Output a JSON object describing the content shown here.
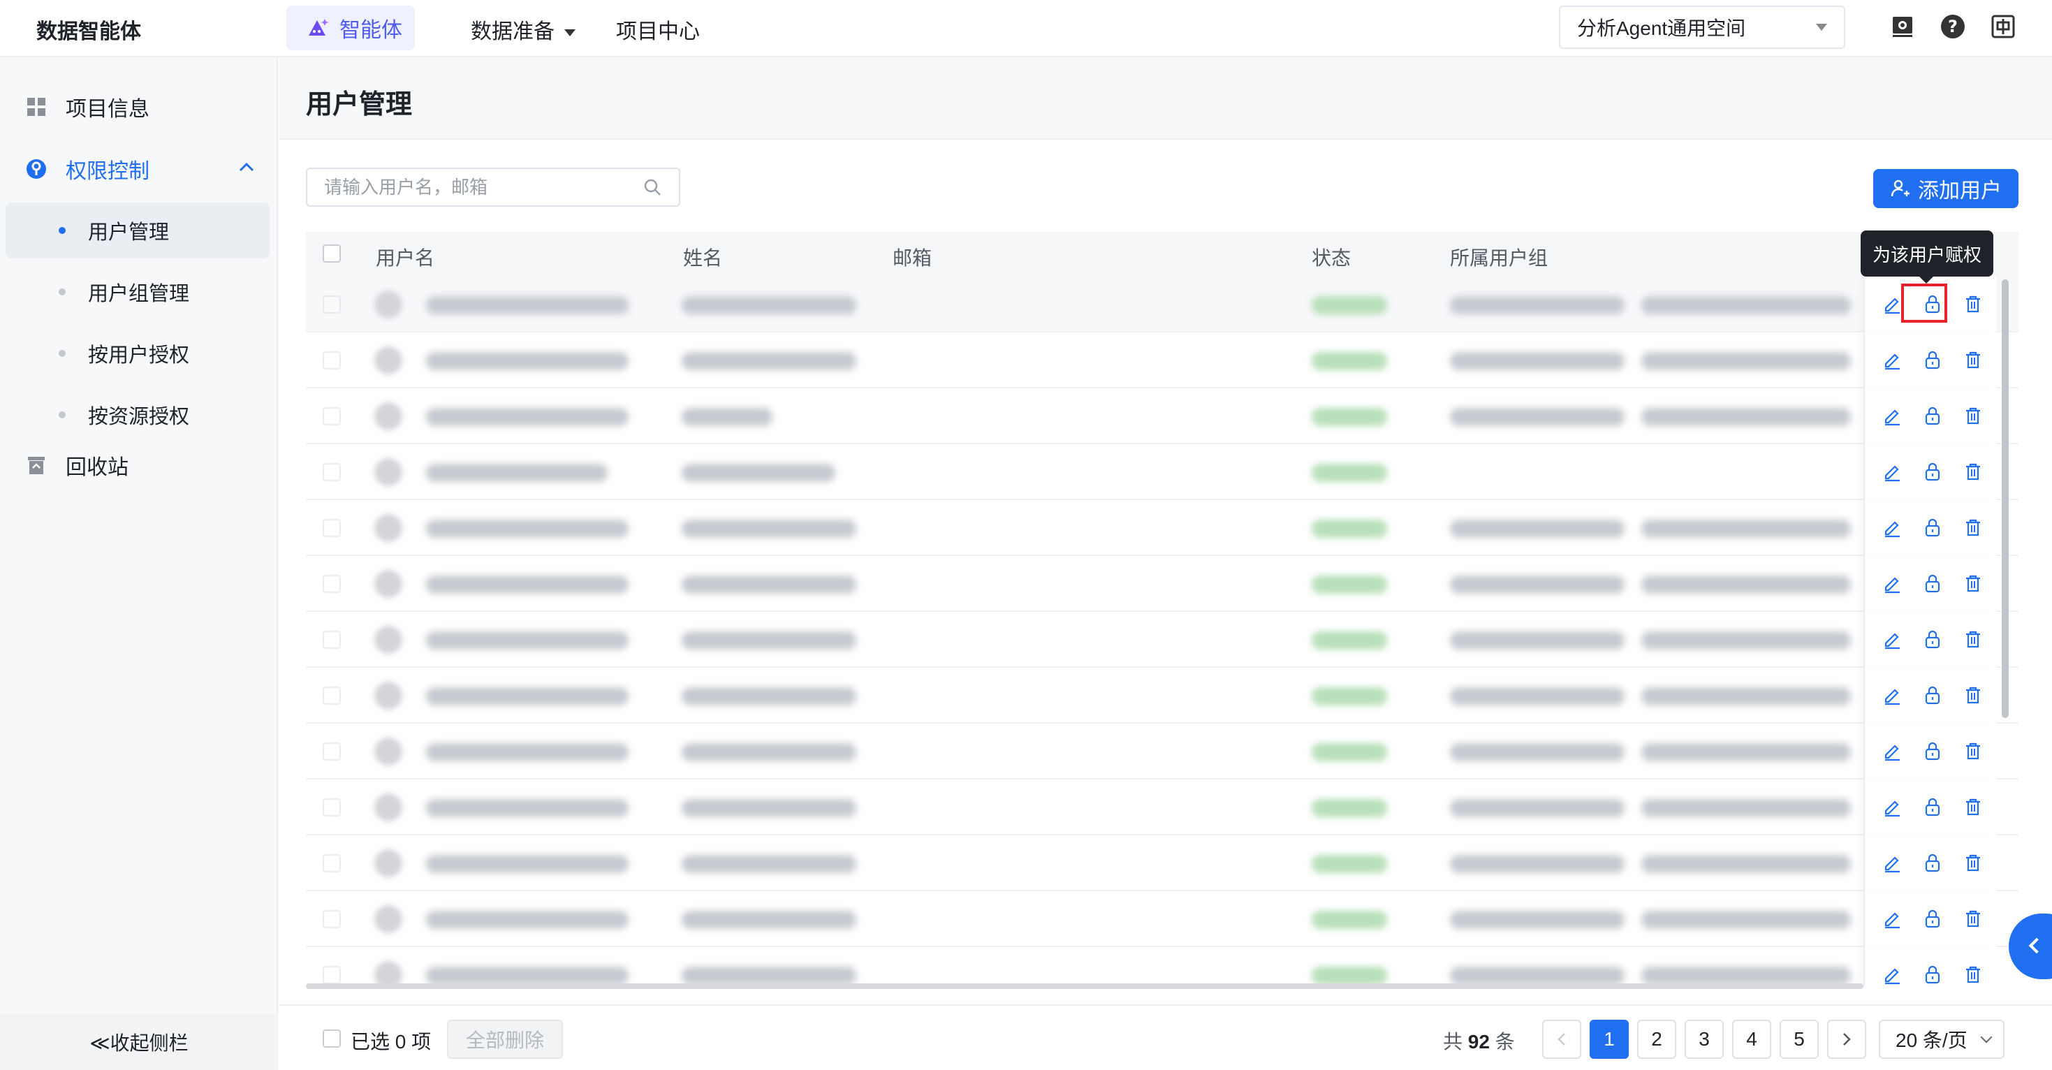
{
  "app": {
    "title": "数据智能体"
  },
  "topnav": {
    "agent_label": "智能体",
    "data_prep_label": "数据准备",
    "project_center_label": "项目中心",
    "workspace": "分析Agent通用空间"
  },
  "sidebar": {
    "items": [
      {
        "label": "项目信息",
        "icon": "grid-icon"
      },
      {
        "label": "权限控制",
        "icon": "key-icon"
      },
      {
        "label": "回收站",
        "icon": "recycle-bin-icon"
      }
    ],
    "subitems": [
      {
        "label": "用户管理"
      },
      {
        "label": "用户组管理"
      },
      {
        "label": "按用户授权"
      },
      {
        "label": "按资源授权"
      }
    ],
    "collapse_label": "≪收起侧栏"
  },
  "page": {
    "title": "用户管理",
    "search_placeholder": "请输入用户名，邮箱",
    "add_user_label": "添加用户"
  },
  "table": {
    "columns": [
      "用户名",
      "姓名",
      "邮箱",
      "状态",
      "所属用户组"
    ],
    "tooltip": "为该用户赋权",
    "visible_row_count": 13
  },
  "footer": {
    "selected_label": "已选 0 项",
    "delete_all_label": "全部删除",
    "total_prefix": "共",
    "total_count": "92",
    "total_suffix": "条",
    "pages": [
      "1",
      "2",
      "3",
      "4",
      "5"
    ],
    "current_page": "1",
    "page_size": "20 条/页"
  },
  "colors": {
    "accent": "#1f6ff0",
    "agent": "#4e5bf0",
    "highlight": "#e8222a"
  }
}
